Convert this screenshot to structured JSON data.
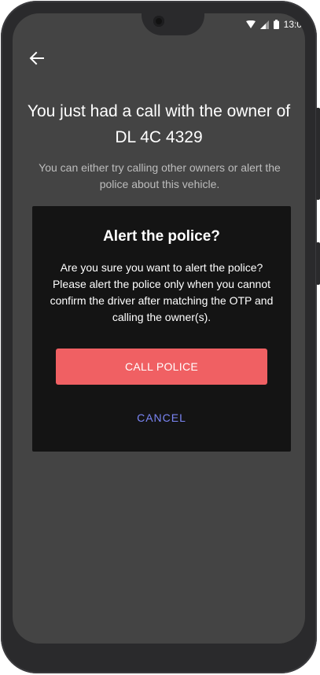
{
  "status_bar": {
    "time": "13:0",
    "icons": [
      "wifi-icon",
      "cellular-signal-icon",
      "battery-icon"
    ]
  },
  "header": {
    "back_icon": "arrow-left-icon"
  },
  "main": {
    "title_line1": "You just had a call with the owner of",
    "title_line2": "DL 4C 4329",
    "subtitle": "You can either try calling other owners or alert the police about this vehicle."
  },
  "dialog": {
    "title": "Alert the police?",
    "body": "Are you sure you want to alert the police? Please alert the police only when you cannot confirm the driver after matching the OTP and calling the owner(s).",
    "primary_label": "CALL POLICE",
    "secondary_label": "CANCEL"
  },
  "colors": {
    "screen_background": "#444444",
    "dialog_background": "#141414",
    "primary_button": "#f06063",
    "secondary_text": "#7b86f5",
    "phone_frame": "#2a2a2c"
  }
}
